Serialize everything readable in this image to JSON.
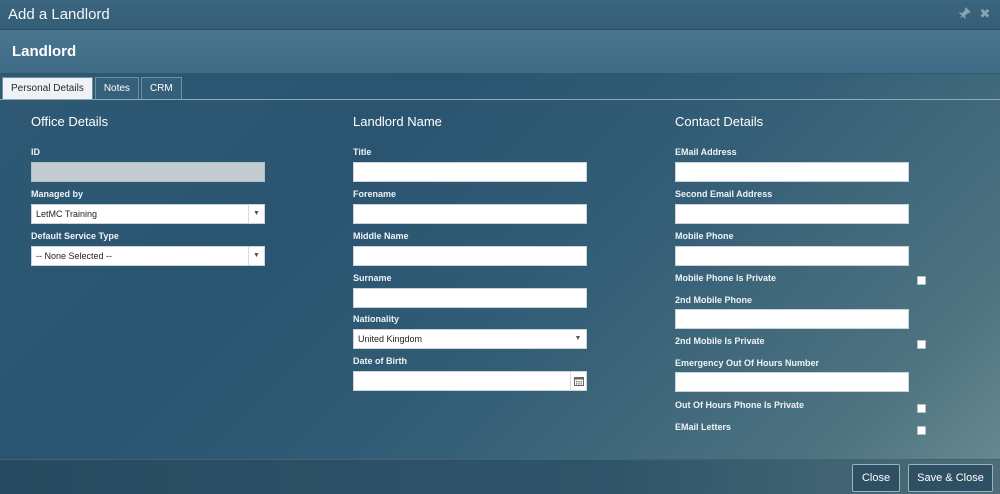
{
  "window": {
    "title": "Add a Landlord"
  },
  "header": {
    "heading": "Landlord"
  },
  "tabs": [
    {
      "label": "Personal Details",
      "active": true
    },
    {
      "label": "Notes",
      "active": false
    },
    {
      "label": "CRM",
      "active": false
    }
  ],
  "office": {
    "heading": "Office Details",
    "id_label": "ID",
    "id_value": "",
    "managed_by_label": "Managed by",
    "managed_by_value": "LetMC Training",
    "service_type_label": "Default Service Type",
    "service_type_value": "-- None Selected --"
  },
  "landlord_name": {
    "heading": "Landlord Name",
    "title_label": "Title",
    "title_value": "",
    "forename_label": "Forename",
    "forename_value": "",
    "middle_name_label": "Middle Name",
    "middle_name_value": "",
    "surname_label": "Surname",
    "surname_value": "",
    "nationality_label": "Nationality",
    "nationality_value": "United Kingdom",
    "dob_label": "Date of Birth",
    "dob_value": ""
  },
  "contact": {
    "heading": "Contact Details",
    "email_label": "EMail Address",
    "email_value": "",
    "second_email_label": "Second Email Address",
    "second_email_value": "",
    "mobile_label": "Mobile Phone",
    "mobile_value": "",
    "mobile_private_label": "Mobile Phone Is Private",
    "mobile2_label": "2nd Mobile Phone",
    "mobile2_value": "",
    "mobile2_private_label": "2nd Mobile Is Private",
    "emergency_label": "Emergency Out Of Hours Number",
    "emergency_value": "",
    "ooh_private_label": "Out Of Hours Phone Is Private",
    "email_letters_label": "EMail Letters"
  },
  "footer": {
    "close_label": "Close",
    "save_close_label": "Save & Close"
  },
  "icons": {
    "pin": "pin-icon",
    "close": "close-icon",
    "calendar": "calendar-icon",
    "caret": "chevron-down-icon"
  }
}
